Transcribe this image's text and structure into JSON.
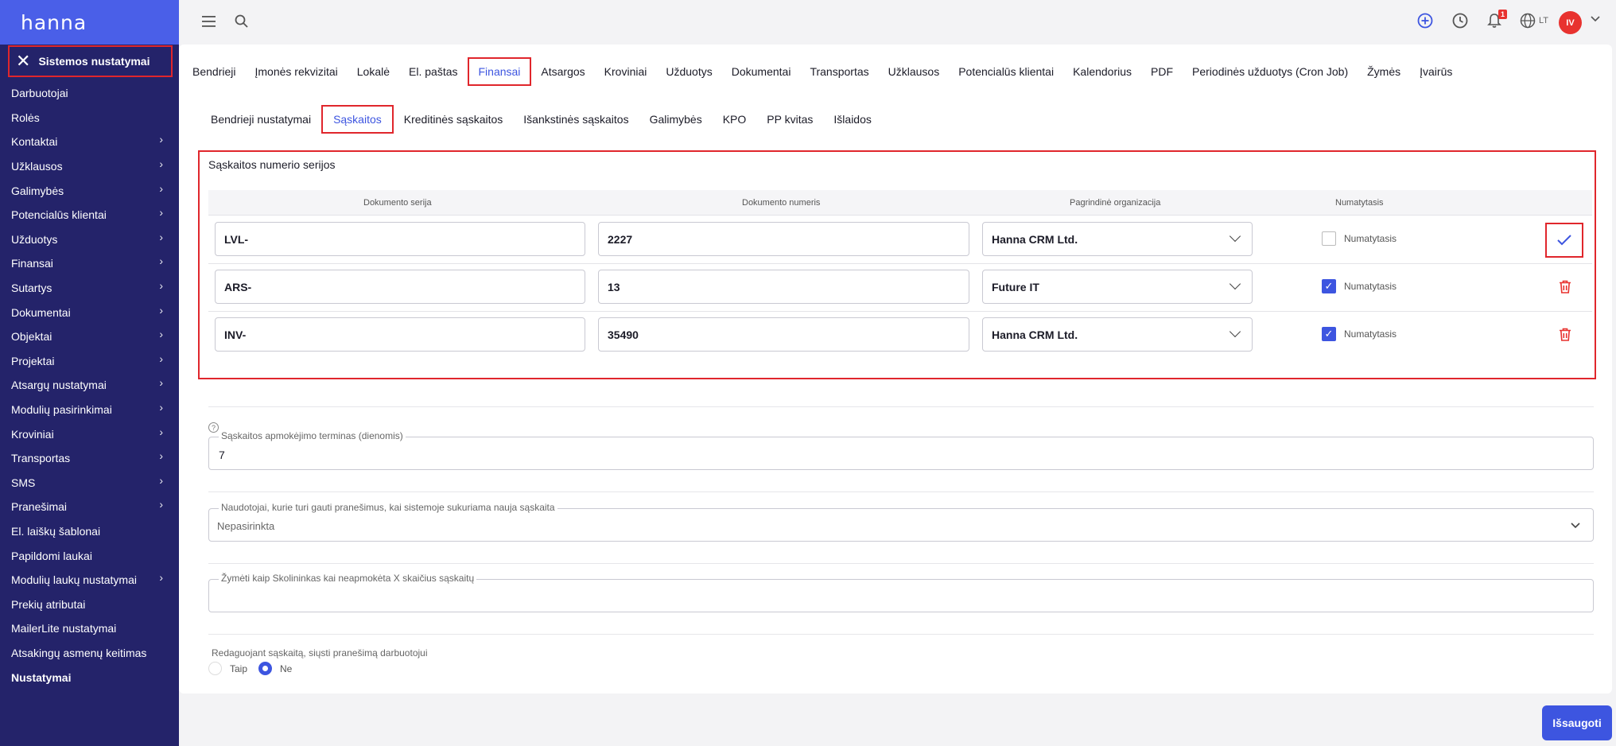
{
  "app": {
    "logo": "hanna"
  },
  "sidebar": {
    "header": "Sistemos nustatymai",
    "items": [
      {
        "label": "Darbuotojai",
        "has_children": false
      },
      {
        "label": "Rolės",
        "has_children": false
      },
      {
        "label": "Kontaktai",
        "has_children": true
      },
      {
        "label": "Užklausos",
        "has_children": true
      },
      {
        "label": "Galimybės",
        "has_children": true
      },
      {
        "label": "Potencialūs klientai",
        "has_children": true
      },
      {
        "label": "Užduotys",
        "has_children": true
      },
      {
        "label": "Finansai",
        "has_children": true
      },
      {
        "label": "Sutartys",
        "has_children": true
      },
      {
        "label": "Dokumentai",
        "has_children": true
      },
      {
        "label": "Objektai",
        "has_children": true
      },
      {
        "label": "Projektai",
        "has_children": true
      },
      {
        "label": "Atsargų nustatymai",
        "has_children": true
      },
      {
        "label": "Modulių pasirinkimai",
        "has_children": true
      },
      {
        "label": "Kroviniai",
        "has_children": true
      },
      {
        "label": "Transportas",
        "has_children": true
      },
      {
        "label": "SMS",
        "has_children": true
      },
      {
        "label": "Pranešimai",
        "has_children": true
      },
      {
        "label": "El. laiškų šablonai",
        "has_children": false
      },
      {
        "label": "Papildomi laukai",
        "has_children": false
      },
      {
        "label": "Modulių laukų nustatymai",
        "has_children": true
      },
      {
        "label": "Prekių atributai",
        "has_children": false
      },
      {
        "label": "MailerLite nustatymai",
        "has_children": false
      },
      {
        "label": "Atsakingų asmenų keitimas",
        "has_children": false
      },
      {
        "label": "Nustatymai",
        "has_children": false,
        "active": true
      }
    ]
  },
  "topbar": {
    "notification_count": "1",
    "language": "LT",
    "avatar_initials": "IV",
    "icons": [
      "menu-icon",
      "search-icon",
      "add-icon",
      "clock-icon",
      "bell-icon",
      "globe-icon",
      "chevron-down-icon"
    ]
  },
  "tabs": [
    {
      "label": "Bendrieji"
    },
    {
      "label": "Įmonės rekvizitai"
    },
    {
      "label": "Lokalė"
    },
    {
      "label": "El. paštas"
    },
    {
      "label": "Finansai",
      "active": true
    },
    {
      "label": "Atsargos"
    },
    {
      "label": "Kroviniai"
    },
    {
      "label": "Užduotys"
    },
    {
      "label": "Dokumentai"
    },
    {
      "label": "Transportas"
    },
    {
      "label": "Užklausos"
    },
    {
      "label": "Potencialūs klientai"
    },
    {
      "label": "Kalendorius"
    },
    {
      "label": "PDF"
    },
    {
      "label": "Periodinės užduotys (Cron Job)"
    },
    {
      "label": "Žymės"
    },
    {
      "label": "Įvairūs"
    }
  ],
  "subtabs": [
    {
      "label": "Bendrieji nustatymai"
    },
    {
      "label": "Sąskaitos",
      "active": true
    },
    {
      "label": "Kreditinės sąskaitos"
    },
    {
      "label": "Išankstinės sąskaitos"
    },
    {
      "label": "Galimybės"
    },
    {
      "label": "KPO"
    },
    {
      "label": "PP kvitas"
    },
    {
      "label": "Išlaidos"
    }
  ],
  "series": {
    "title": "Sąskaitos numerio serijos",
    "columns": [
      "Dokumento serija",
      "Dokumento numeris",
      "Pagrindinė organizacija",
      "Numatytasis"
    ],
    "checkbox_label": "Numatytasis",
    "rows": [
      {
        "series": "LVL-",
        "number": "2227",
        "organization": "Hanna CRM Ltd.",
        "default": false,
        "action": "confirm"
      },
      {
        "series": "ARS-",
        "number": "13",
        "organization": "Future IT",
        "default": true,
        "action": "delete"
      },
      {
        "series": "INV-",
        "number": "35490",
        "organization": "Hanna CRM Ltd.",
        "default": true,
        "action": "delete"
      }
    ]
  },
  "payment_term": {
    "label": "Sąskaitos apmokėjimo terminas (dienomis)",
    "value": "7"
  },
  "notify_users": {
    "label": "Naudotojai, kurie turi gauti pranešimus, kai sistemoje sukuriama nauja sąskaita",
    "value": "Nepasirinkta"
  },
  "debtor": {
    "label": "Žymėti kaip Skolininkas kai neapmokėta X skaičius sąskaitų",
    "value": ""
  },
  "edit_notify": {
    "question": "Redaguojant sąskaitą, siųsti pranešimą darbuotojui",
    "options": [
      "Taip",
      "Ne"
    ],
    "selected": "Ne"
  },
  "save_label": "Išsaugoti",
  "colors": {
    "accent": "#3d55e0",
    "sidebar": "#24236a",
    "logo_bar": "#4a5fe8",
    "highlight": "#e0262c",
    "danger": "#e8322f"
  }
}
